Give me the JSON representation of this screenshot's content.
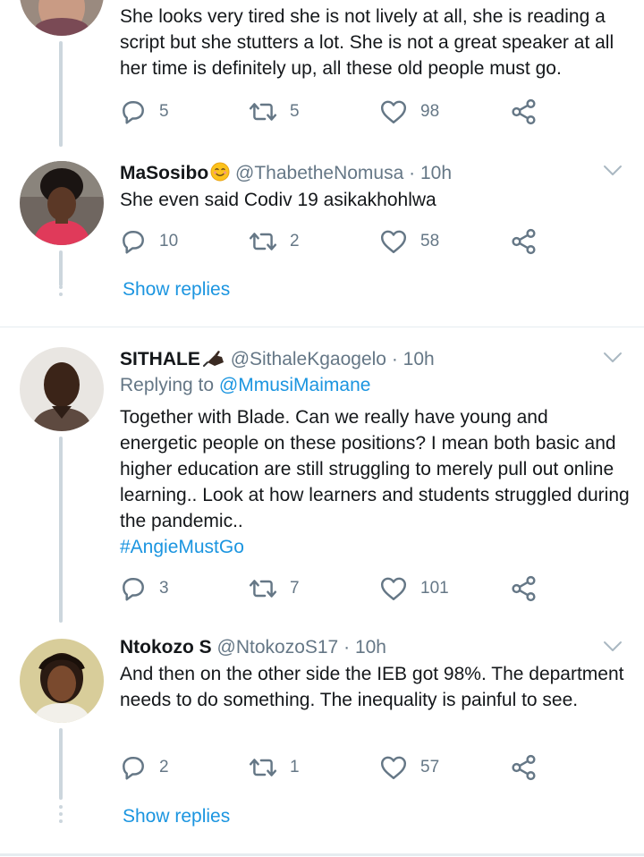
{
  "tweets": [
    {
      "name": "",
      "handle": "",
      "time": "",
      "text": "She looks very tired she is not lively at all, she is reading a script but she stutters a lot. She is not a great speaker at all her time is definitely up, all these old people must go.",
      "replies": "5",
      "retweets": "5",
      "likes": "98"
    },
    {
      "name": "MaSosibo",
      "name_emoji": "smiling-face-icon",
      "handle": "@ThabetheNomusa",
      "sep": "·",
      "time": "10h",
      "text": "She even said Codiv 19 asikakhohlwa",
      "replies": "10",
      "retweets": "2",
      "likes": "58",
      "show_replies": "Show replies"
    },
    {
      "name": "SITHALE",
      "name_emoji": "writing-hand-icon",
      "handle": "@SithaleKgaogelo",
      "sep": "·",
      "time": "10h",
      "replying_prefix": "Replying to",
      "replying_to": "@MmusiMaimane",
      "text": "Together with Blade. Can we really have young and energetic people on these positions? I mean both basic and higher education are still struggling to merely pull out online learning.. Look at how learners and students struggled during the pandemic..",
      "hashtag": "#AngieMustGo",
      "replies": "3",
      "retweets": "7",
      "likes": "101"
    },
    {
      "name": "Ntokozo S",
      "handle": "@NtokozoS17",
      "sep": "·",
      "time": "10h",
      "text": "And then on the other side the IEB got 98%. The department needs to do something. The inequality is painful to see.",
      "replies": "2",
      "retweets": "1",
      "likes": "57",
      "show_replies": "Show replies"
    }
  ],
  "colors": {
    "link": "#1b95e0",
    "muted": "#657786",
    "text": "#14171a",
    "divider": "#e6ecf0",
    "thread": "#ccd6dd"
  }
}
